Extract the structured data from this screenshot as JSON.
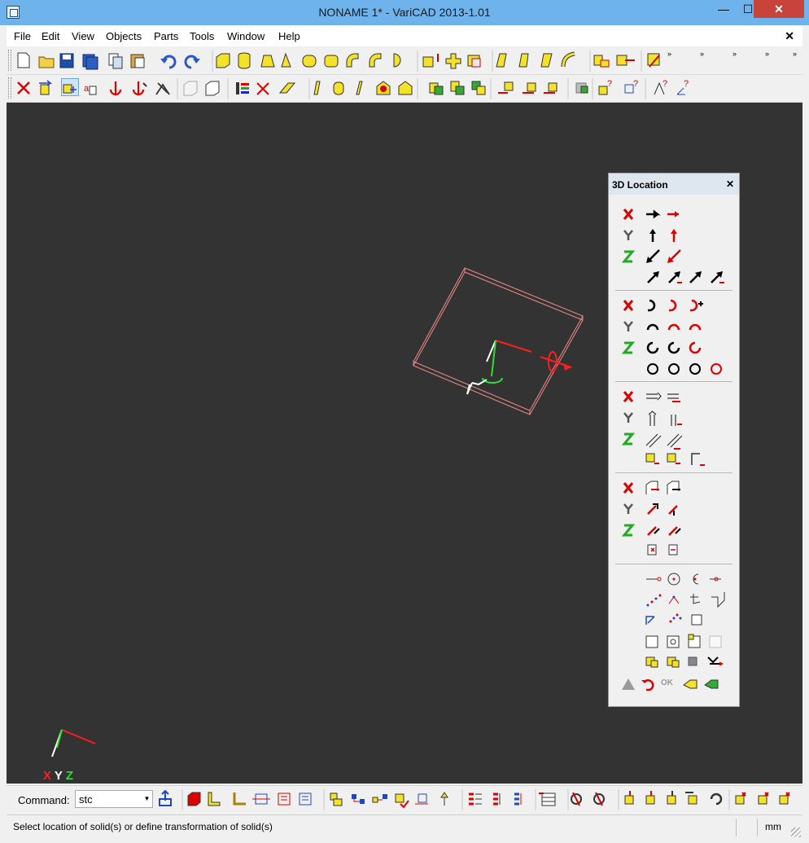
{
  "window": {
    "title": "NONAME 1* - VariCAD 2013-1.01",
    "min_glyph": "—",
    "max_glyph": "☐",
    "close_glyph": "✕"
  },
  "menu": {
    "items": [
      "File",
      "Edit",
      "View",
      "Objects",
      "Parts",
      "Tools",
      "Window",
      "Help"
    ],
    "mdi_close": "✕"
  },
  "toolbar1": {
    "icons": [
      "new-file-icon",
      "open-folder-icon",
      "save-icon",
      "save-all-icon",
      "copy-icon",
      "paste-icon",
      "undo-icon",
      "redo-icon",
      "box-solid-icon",
      "cylinder-solid-icon",
      "prism-solid-icon",
      "cone-solid-icon",
      "tube-solid-icon",
      "pipe-solid-icon",
      "elbow-solid-icon",
      "bend-solid-icon",
      "half-sphere-solid-icon",
      "extrude-icon",
      "add-solids-icon",
      "subtract-solids-icon",
      "fillet-icon",
      "chamfer-icon",
      "slice-icon",
      "curve-solid-icon",
      "insert-solid-icon",
      "move-solid-icon",
      "rotate-solid-icon"
    ]
  },
  "toolbar2": {
    "icons": [
      "delete-solid-icon",
      "transform-solid-icon",
      "edit-solid-icon",
      "attribute-icon",
      "anchor-icon",
      "anchor-red-icon",
      "split-icon",
      "hide-box-icon",
      "show-box-icon",
      "color-icon",
      "scissors-icon",
      "shaft-icon",
      "thread-icon",
      "bolt-icon",
      "cut-icon",
      "round-box-icon",
      "chamfer-box-icon",
      "add-solid-icon",
      "subtract-solid-icon",
      "intersect-solid-icon",
      "move-edge-icon",
      "move-face-icon",
      "move-vertex-icon",
      "check-icon",
      "query-solid-icon",
      "query-distance-icon",
      "query-angle-icon",
      "query-axis-icon"
    ]
  },
  "viewport": {
    "background": "#333333",
    "axis_labels": {
      "x": "X",
      "y": "Y",
      "z": "Z"
    },
    "colors": {
      "x": "#ff1e1e",
      "y": "#ffffff",
      "z": "#2ee02e",
      "solid": "#f08a8a"
    }
  },
  "panel": {
    "title": "3D Location",
    "close_glyph": "✕"
  },
  "command": {
    "label": "Command:",
    "value": "stc"
  },
  "bottom_toolbar": {
    "icons": [
      "export-icon",
      "box-icon",
      "pipe-icon",
      "profile-icon",
      "section-icon",
      "section-red-icon",
      "section-blue-icon",
      "assembly-icon",
      "tree-icon",
      "link-icon",
      "attach-icon",
      "measure-icon",
      "pin-icon",
      "list-red-icon",
      "list-red2-icon",
      "list-blue-icon",
      "table-icon",
      "unlink-icon",
      "unlink2-icon",
      "update-icon",
      "update2-icon",
      "update3-icon",
      "update4-icon",
      "refresh-icon",
      "copy-red-icon",
      "delete-red-icon",
      "delete-red2-icon"
    ]
  },
  "status": {
    "message": "Select location of solid(s) or define transformation of solid(s)",
    "unit": "mm"
  }
}
